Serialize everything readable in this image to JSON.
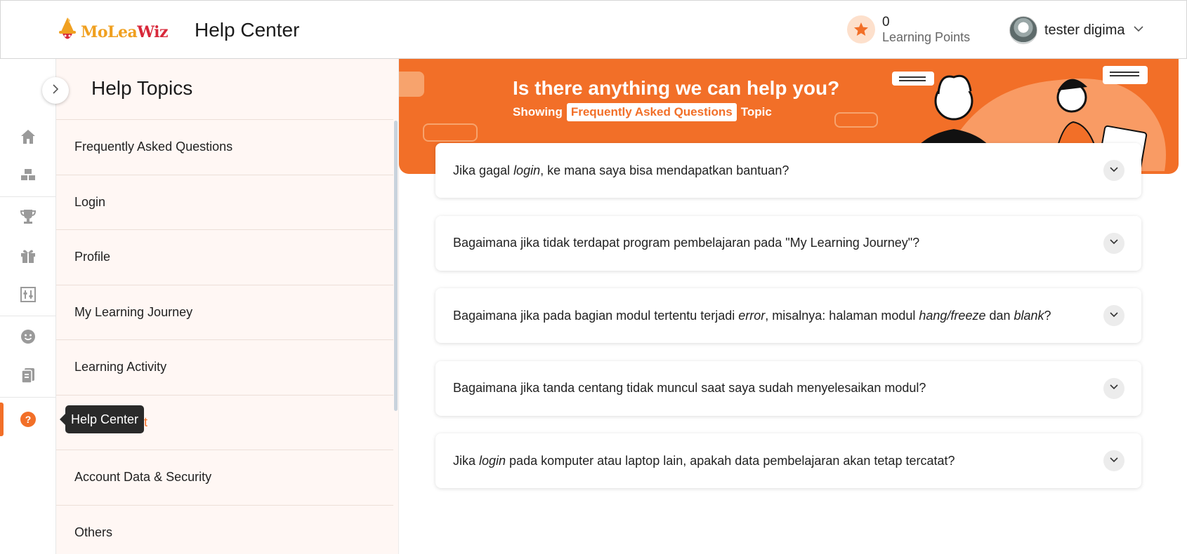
{
  "header": {
    "logo_parts": [
      "Mo",
      "Lea",
      "Wiz"
    ],
    "title": "Help Center",
    "points_value": "0",
    "points_label": "Learning Points",
    "user_name": "tester digima"
  },
  "rail": {
    "icons": [
      "home-icon",
      "blocks-icon",
      "trophy-icon",
      "gift-icon",
      "sliders-icon",
      "smiley-icon",
      "clipboard-icon",
      "help-icon"
    ],
    "tooltip": "Help Center"
  },
  "topics": {
    "title": "Help Topics",
    "items": [
      {
        "label": "Frequently Asked Questions",
        "active": false
      },
      {
        "label": "Login",
        "active": false
      },
      {
        "label": "Profile",
        "active": false
      },
      {
        "label": "My Learning Journey",
        "active": false
      },
      {
        "label": "Learning Activity",
        "active": false
      },
      {
        "label": "Achievement",
        "active": true
      },
      {
        "label": "Account Data & Security",
        "active": false
      },
      {
        "label": "Others",
        "active": false
      }
    ]
  },
  "banner": {
    "heading": "Is there anything we can help you?",
    "showing": "Showing",
    "tag": "Frequently Asked Questions",
    "topic": "Topic"
  },
  "faq": [
    {
      "parts": [
        [
          "Jika gagal ",
          false
        ],
        [
          "login",
          true
        ],
        [
          ", ke mana saya bisa mendapatkan bantuan?",
          false
        ]
      ]
    },
    {
      "parts": [
        [
          "Bagaimana jika tidak terdapat program pembelajaran pada \"My Learning Journey\"?",
          false
        ]
      ]
    },
    {
      "parts": [
        [
          "Bagaimana jika pada bagian modul tertentu terjadi ",
          false
        ],
        [
          "error",
          true
        ],
        [
          ", misalnya: halaman modul ",
          false
        ],
        [
          "hang/freeze",
          true
        ],
        [
          " dan ",
          false
        ],
        [
          "blank",
          true
        ],
        [
          "?",
          false
        ]
      ]
    },
    {
      "parts": [
        [
          "Bagaimana jika tanda centang tidak muncul saat saya sudah menyelesaikan modul?",
          false
        ]
      ]
    },
    {
      "parts": [
        [
          "Jika ",
          false
        ],
        [
          "login",
          true
        ],
        [
          " pada komputer atau laptop lain, apakah data pembelajaran akan tetap tercatat?",
          false
        ]
      ]
    }
  ],
  "colors": {
    "accent": "#f26f28",
    "panel_bg": "#fff7f4"
  }
}
